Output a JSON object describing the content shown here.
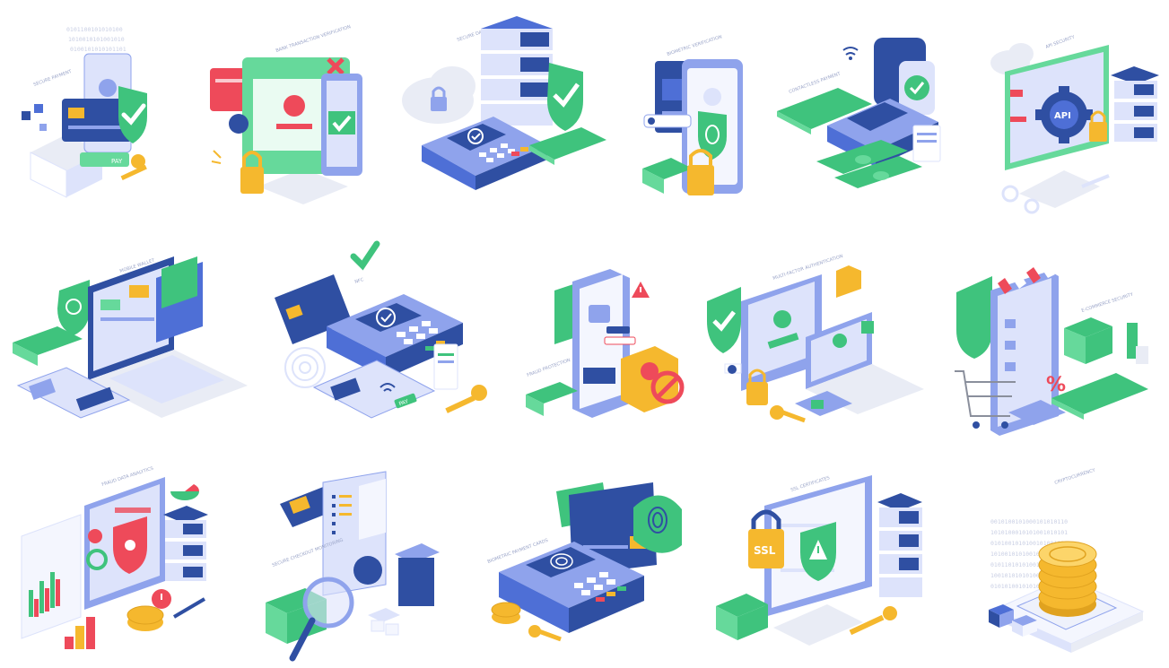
{
  "image": {
    "background": "#ffffff",
    "style": "isometric security and payment illustrations"
  },
  "colors": {
    "navy": "#2f4fa2",
    "blue": "#4e6fd6",
    "periwinkle": "#8fa3ec",
    "lavender": "#dde3fb",
    "green": "#3fc37d",
    "mint": "#66d99b",
    "yellow": "#f5b82e",
    "red": "#ee4a5a",
    "gray": "#e9ecf5"
  },
  "icons": [
    {
      "name": "secure-card-payment-icon",
      "label": "SECURE PAYMENT"
    },
    {
      "name": "bank-transaction-verification-icon",
      "label": "BANK TRANSACTION VERIFICATION"
    },
    {
      "name": "secure-data-systems-icon",
      "label": "SECURE DATA SYSTEMS"
    },
    {
      "name": "biometric-verification-icon",
      "label": "BIOMETRIC VERIFICATION"
    },
    {
      "name": "contactless-payment-icon",
      "label": "CONTACTLESS PAYMENT"
    },
    {
      "name": "api-security-icon",
      "label": "API SECURITY"
    },
    {
      "name": "mobile-wallet-icon",
      "label": "MOBILE WALLET"
    },
    {
      "name": "nfc-terminal-icon",
      "label": "NFC"
    },
    {
      "name": "fraud-protection-icon",
      "label": "FRAUD PROTECTION"
    },
    {
      "name": "multi-factor-authentication-icon",
      "label": "MULTI-FACTOR AUTHENTICATION"
    },
    {
      "name": "ecommerce-security-icon",
      "label": "E-COMMERCE SECURITY"
    },
    {
      "name": "fraud-data-analytics-icon",
      "label": "FRAUD DATA ANALYTICS"
    },
    {
      "name": "secure-checkout-monitoring-icon",
      "label": "SECURE CHECKOUT MONITORING"
    },
    {
      "name": "biometric-payment-cards-icon",
      "label": "BIOMETRIC PAYMENT CARDS"
    },
    {
      "name": "ssl-certificates-icon",
      "label": "SSL CERTIFICATES"
    },
    {
      "name": "cryptocurrency-icon",
      "label": "CRYPTOCURRENCY"
    }
  ],
  "texts": {
    "pay_1": "PAY",
    "pay_2": "PAY",
    "api": "API",
    "ssl": "SSL",
    "percent": "%",
    "binary_1": "0010100101000101010110",
    "binary_2": "1010100010101001010101",
    "binary_3": "0101001010100101001010"
  }
}
